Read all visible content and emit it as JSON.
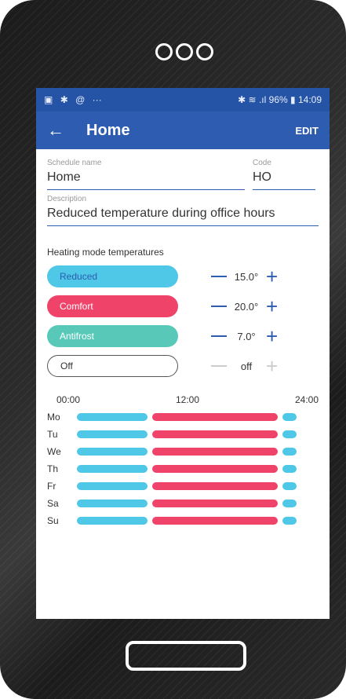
{
  "status": {
    "left_icons": [
      "image-icon",
      "bluetooth-icon",
      "at-icon",
      "…"
    ],
    "right_text": "96%",
    "time": "14:09"
  },
  "appbar": {
    "back": "←",
    "title": "Home",
    "edit": "EDIT"
  },
  "fields": {
    "schedule_name_label": "Schedule name",
    "schedule_name_value": "Home",
    "code_label": "Code",
    "code_value": "HO",
    "description_label": "Description",
    "description_value": "Reduced temperature during office hours"
  },
  "heating": {
    "title": "Heating mode temperatures",
    "modes": [
      {
        "name": "Reduced",
        "value": "15.0°",
        "color": "#4ec8e6",
        "text_color": "#2d5cb0"
      },
      {
        "name": "Comfort",
        "value": "20.0°",
        "color": "#f0436a",
        "text_color": "#ffffff"
      },
      {
        "name": "Antifrost",
        "value": "7.0°",
        "color": "#58c9b8",
        "text_color": "#ffffff"
      },
      {
        "name": "Off",
        "value": "off",
        "color": "#ffffff",
        "text_color": "#333333"
      }
    ]
  },
  "schedule": {
    "times": [
      "00:00",
      "12:00",
      "24:00"
    ],
    "days": [
      "Mo",
      "Tu",
      "We",
      "Th",
      "Fr",
      "Sa",
      "Su"
    ]
  },
  "colors": {
    "reduced": "#4ec8e6",
    "comfort": "#f0436a",
    "primary": "#2d5cb0"
  }
}
